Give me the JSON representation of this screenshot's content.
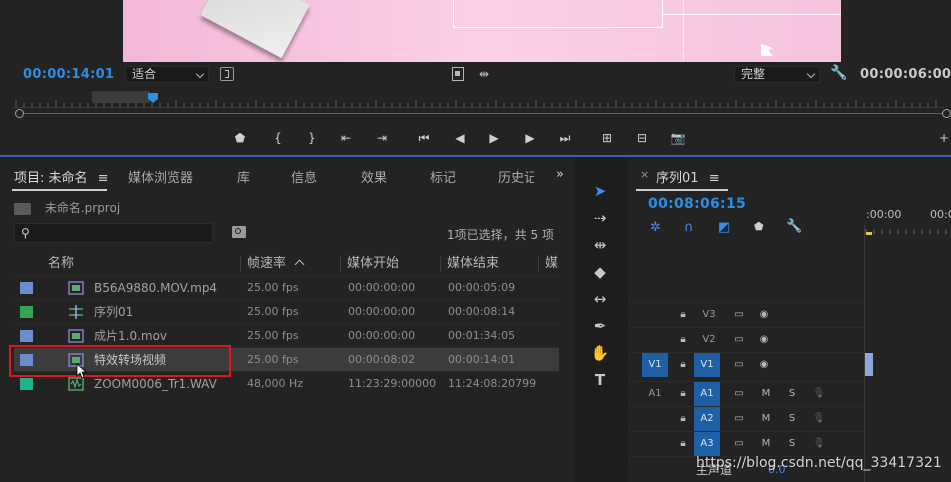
{
  "monitor": {
    "current_timecode": "00:00:14:01",
    "zoom_label": "适合",
    "quality_label": "完整",
    "duration_timecode": "00:00:06:00",
    "playhead_position": 0.145
  },
  "project": {
    "tabs": [
      "项目: 未命名",
      "媒体浏览器",
      "库",
      "信息",
      "效果",
      "标记",
      "历史记"
    ],
    "filename": "未命名.prproj",
    "search_placeholder": "",
    "selection_status": "1项已选择，共 5 项",
    "columns": [
      "名称",
      "帧速率",
      "媒体开始",
      "媒体结束",
      "媒"
    ],
    "items": [
      {
        "name": "B56A9880.MOV.mp4",
        "fps": "25.00 fps",
        "start": "00:00:00:00",
        "end": "00:00:05:09",
        "color": "#6a8ccc",
        "type": "video"
      },
      {
        "name": "序列01",
        "fps": "25.00 fps",
        "start": "00:00:00:00",
        "end": "00:00:08:14",
        "color": "#34a653",
        "type": "sequence"
      },
      {
        "name": "成片1.0.mov",
        "fps": "25.00 fps",
        "start": "00:00:00:00",
        "end": "00:01:34:05",
        "color": "#6a8ccc",
        "type": "video"
      },
      {
        "name": "特效转场视频",
        "fps": "25.00 fps",
        "start": "00:00:08:02",
        "end": "00:00:14:01",
        "color": "#6a8ccc",
        "type": "video",
        "selected": true
      },
      {
        "name": "ZOOM0006_Tr1.WAV",
        "fps": "48,000 Hz",
        "start": "11:23:29:00000",
        "end": "11:24:08:20799",
        "color": "#21b38a",
        "type": "audio"
      }
    ]
  },
  "timeline": {
    "sequence_tab": "序列01",
    "timecode": "00:08:06:15",
    "ruler_labels": [
      ":00:00",
      "00:0"
    ],
    "tracks": [
      {
        "name": "V3",
        "kind": "video"
      },
      {
        "name": "V2",
        "kind": "video"
      },
      {
        "name": "V1",
        "kind": "video",
        "source": "V1"
      },
      {
        "name": "A1",
        "kind": "audio",
        "source": "A1"
      },
      {
        "name": "A2",
        "kind": "audio"
      },
      {
        "name": "A3",
        "kind": "audio"
      }
    ],
    "master_label": "主声道",
    "master_value": "0.0",
    "mute_label": "M",
    "solo_label": "S"
  },
  "watermark": "https://blog.csdn.net/qq_33417321"
}
